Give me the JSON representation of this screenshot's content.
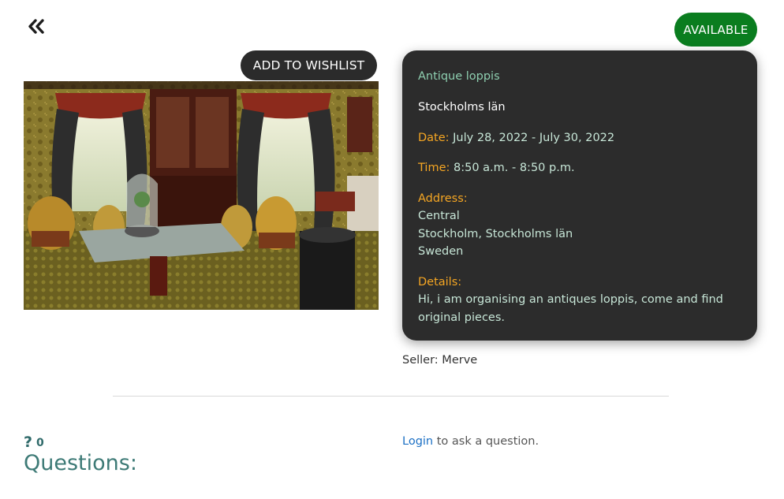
{
  "nav": {
    "back_icon": "double-chevron-left-icon"
  },
  "status": {
    "label": "AVAILABLE",
    "color": "#0a7d1f"
  },
  "wishlist": {
    "label": "ADD TO WISHLIST"
  },
  "listing": {
    "title": "Antique loppis",
    "region": "Stockholms län",
    "date_label": "Date:",
    "date_value": "July 28, 2022 - July 30, 2022",
    "time_label": "Time:",
    "time_value": "8:50 a.m. - 8:50 p.m.",
    "address_label": "Address:",
    "address_lines": [
      "Central",
      "Stockholm, Stockholms län",
      "Sweden"
    ],
    "details_label": "Details:",
    "details_text": "Hi, i am organising an antiques loppis, come and find original pieces."
  },
  "seller": {
    "text": "Seller: Merve"
  },
  "questions": {
    "icon": "question-mark-icon",
    "count": "0",
    "heading": "Questions:",
    "login_link": "Login",
    "login_suffix": " to ask a question."
  },
  "colors": {
    "accent_label": "#f5a623",
    "card_bg": "#2c2c2c",
    "heading_teal": "#3d7a76",
    "link": "#1a6fc4"
  }
}
